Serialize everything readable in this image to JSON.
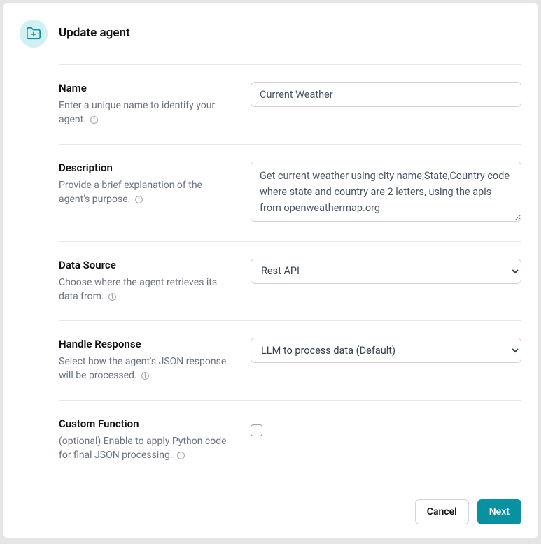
{
  "header": {
    "title": "Update agent"
  },
  "fields": {
    "name": {
      "label": "Name",
      "description": "Enter a unique name to identify your agent.",
      "value": "Current Weather"
    },
    "description": {
      "label": "Description",
      "description": "Provide a brief explanation of the agent's purpose.",
      "value": "Get current weather using city name,State,Country code where state and country are 2 letters, using the apis from openweathermap.org"
    },
    "dataSource": {
      "label": "Data Source",
      "description": "Choose where the agent retrieves its data from.",
      "value": "Rest API"
    },
    "handleResponse": {
      "label": "Handle Response",
      "description": "Select how the agent's JSON response will be processed.",
      "value": "LLM to process data (Default)"
    },
    "customFunction": {
      "label": "Custom Function",
      "description": "(optional) Enable to apply Python code for final JSON processing.",
      "checked": false
    }
  },
  "footer": {
    "cancel": "Cancel",
    "next": "Next"
  }
}
